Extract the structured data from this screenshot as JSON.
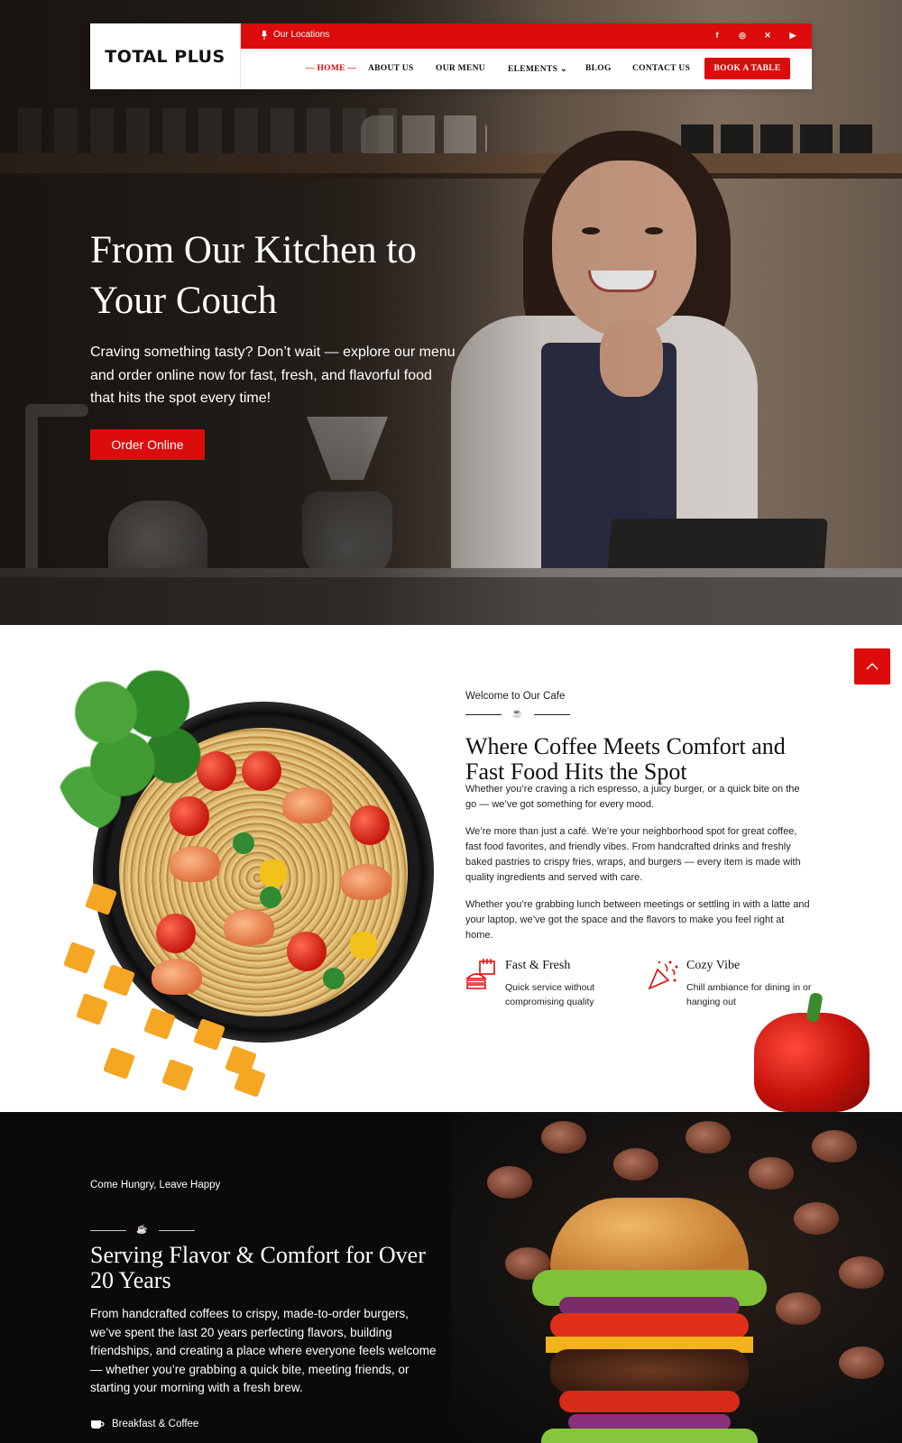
{
  "header": {
    "logo": "TOTAL PLUS",
    "locations_label": "Our Locations",
    "social_icons": [
      "facebook-icon",
      "instagram-icon",
      "x-icon",
      "youtube-icon"
    ],
    "nav": [
      {
        "label": "— HOME —",
        "active": true
      },
      {
        "label": "ABOUT US"
      },
      {
        "label": "OUR MENU"
      },
      {
        "label": "ELEMENTS ⌄"
      },
      {
        "label": "BLOG"
      },
      {
        "label": "CONTACT US"
      }
    ],
    "cta": "BOOK A TABLE"
  },
  "hero": {
    "title_line1": "From Our Kitchen to",
    "title_line2": "Your Couch",
    "text": "Craving something tasty? Don’t wait — explore our menu and order online now for fast, fresh, and flavorful food that hits the spot every time!",
    "button": "Order Online"
  },
  "about": {
    "eyebrow": "Welcome to Our Cafe",
    "title": "Where Coffee Meets Comfort and Fast Food Hits the Spot",
    "p1": "Whether you’re craving a rich espresso, a juicy burger, or a quick bite on the go — we’ve got something for every mood.",
    "p2": "We’re more than just a café. We’re your neighborhood spot for great coffee, fast food favorites, and friendly vibes. From handcrafted drinks and freshly baked pastries to crispy fries, wraps, and burgers — every item is made with quality ingredients and served with care.",
    "p3": "Whether you’re grabbing lunch between meetings or settling in with a latte and your laptop, we’ve got the space and the flavors to make you feel right at home.",
    "features": [
      {
        "title": "Fast & Fresh",
        "desc": "Quick service without compromising quality"
      },
      {
        "title": "Cozy Vibe",
        "desc": "Chill ambiance for dining in or hanging out"
      }
    ]
  },
  "story": {
    "eyebrow": "Come Hungry, Leave Happy",
    "title": "Serving Flavor & Comfort for Over 20 Years",
    "text": "From handcrafted coffees to crispy, made-to-order burgers, we’ve spent the last 20 years perfecting flavors, building friendships, and creating a place where everyone feels welcome — whether you’re grabbing a quick bite, meeting friends, or starting your morning with a fresh brew.",
    "item": "Breakfast & Coffee"
  },
  "colors": {
    "accent": "#dc0c0c",
    "dark": "#0a0a0a"
  }
}
